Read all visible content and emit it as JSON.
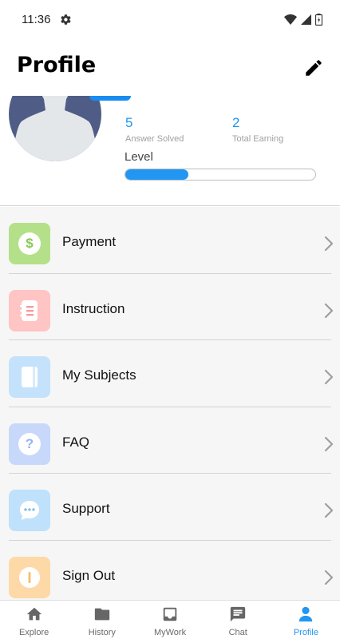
{
  "status_bar": {
    "time": "11:36"
  },
  "header": {
    "title": "Profile"
  },
  "profile": {
    "answers_solved_value": "5",
    "answers_solved_label": "Answer Solved",
    "total_earning_value": "2",
    "total_earning_label": "Total Earning",
    "level_label": "Level",
    "level_progress_fraction": 0.33
  },
  "menu": {
    "items": [
      {
        "label": "Payment",
        "icon": "dollar-icon",
        "icon_bg": "#b5e08a",
        "icon_color": "#8ac657"
      },
      {
        "label": "Instruction",
        "icon": "notebook-icon",
        "icon_bg": "#ffc4c4",
        "icon_color": "#f59c9c"
      },
      {
        "label": "My Subjects",
        "icon": "book-icon",
        "icon_bg": "#c4e2fb",
        "icon_color": "#8fc6f2"
      },
      {
        "label": "FAQ",
        "icon": "question-icon",
        "icon_bg": "#c7d8fb",
        "icon_color": "#93b3f2"
      },
      {
        "label": "Support",
        "icon": "chat-bubble-icon",
        "icon_bg": "#bfe1fb",
        "icon_color": "#86c3f0"
      },
      {
        "label": "Sign Out",
        "icon": "power-icon",
        "icon_bg": "#fdd9a8",
        "icon_color": "#f7bd6a"
      }
    ]
  },
  "bottom_nav": {
    "items": [
      {
        "label": "Explore",
        "icon": "home-icon",
        "active": false
      },
      {
        "label": "History",
        "icon": "folder-icon",
        "active": false
      },
      {
        "label": "MyWork",
        "icon": "inbox-icon",
        "active": false
      },
      {
        "label": "Chat",
        "icon": "chat-icon",
        "active": false
      },
      {
        "label": "Profile",
        "icon": "person-icon",
        "active": true
      }
    ]
  },
  "colors": {
    "accent": "#2196f3",
    "menu_bg": "#f6f6f6",
    "avatar_bg": "#4f5d86"
  }
}
